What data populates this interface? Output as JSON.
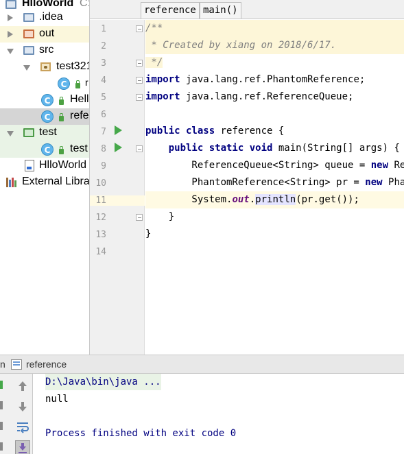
{
  "project": {
    "root_label": "HlloWorld",
    "root_path": "C:",
    "items": [
      {
        "label": ".idea"
      },
      {
        "label": "out"
      },
      {
        "label": "src"
      },
      {
        "label": "test321"
      },
      {
        "label": "r"
      },
      {
        "label": "Hell"
      },
      {
        "label": "refe"
      },
      {
        "label": "test"
      },
      {
        "label": "test"
      },
      {
        "label": "HlloWorld"
      },
      {
        "label": "External Libra"
      }
    ]
  },
  "editor": {
    "tabs": [
      "reference",
      "main()"
    ],
    "line_numbers": [
      "1",
      "2",
      "3",
      "4",
      "5",
      "6",
      "7",
      "8",
      "9",
      "10",
      "11",
      "12",
      "13",
      "14"
    ],
    "lines": {
      "l1": "/**",
      "l2": " * Created by xiang on 2018/6/17.",
      "l3": " */",
      "l4_kw": "import",
      "l4_rest": " java.lang.ref.PhantomReference;",
      "l5_kw": "import",
      "l5_rest": " java.lang.ref.ReferenceQueue;",
      "l7_kw": "public class",
      "l7_rest": " reference {",
      "l8_indent": "    ",
      "l8_kw": "public static void",
      "l8_rest": " main(String[] args) {",
      "l9_pre": "        ReferenceQueue<String> queue = ",
      "l9_kw": "new",
      "l9_post": " Refe",
      "l10_pre": "        PhantomReference<String> pr = ",
      "l10_kw": "new",
      "l10_post": " Phant",
      "l11_pre": "        System.",
      "l11_field": "out",
      "l11_dot": ".",
      "l11_method": "println",
      "l11_post": "(pr.get());",
      "l12": "    }",
      "l13": "}"
    }
  },
  "run": {
    "tab_prefix": "n",
    "tab_label": "reference",
    "console": {
      "command": "D:\\Java\\bin\\java ...",
      "output": "null",
      "exit": "Process finished with exit code 0"
    }
  },
  "colors": {
    "keyword": "#000080",
    "comment": "#808080",
    "static_field": "#660e7a",
    "run_green": "#46a84a",
    "console_exit": "#000080"
  }
}
